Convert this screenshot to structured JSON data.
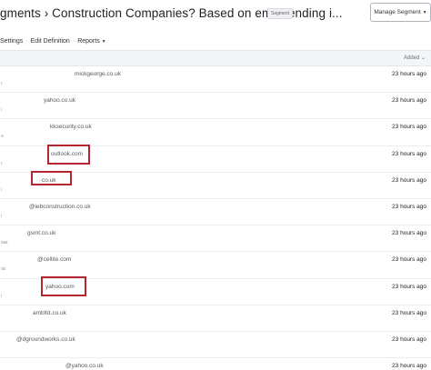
{
  "header": {
    "title": "gments › Construction Companies? Based on email ending i...",
    "badge": "Segment",
    "manage_button": "Manage Segment"
  },
  "subnav": {
    "items": [
      "Settings",
      "Edit Definition",
      "Reports"
    ]
  },
  "table": {
    "column_added": "Added",
    "rows": [
      {
        "left": "",
        "email": "mickgeorge.co.uk",
        "time": "23 hours ago"
      },
      {
        "left": "",
        "email": "yahoo.co.uk",
        "time": "23 hours ago"
      },
      {
        "left": "",
        "email": "kksecurity.co.uk",
        "time": "23 hours ago"
      },
      {
        "left": "",
        "email": "outlook.com",
        "time": "23 hours ago"
      },
      {
        "left": "",
        "email": "co.uk",
        "time": "23 hours ago"
      },
      {
        "left": "",
        "email": "@iebconstruction.co.uk",
        "time": "23 hours ago"
      },
      {
        "left": "Mat",
        "email": "gsmt.co.uk",
        "time": "23 hours ago"
      },
      {
        "left": "Sti",
        "email": "@cellite.com",
        "time": "23 hours ago"
      },
      {
        "left": "",
        "email": "yahoo.com",
        "time": "23 hours ago"
      },
      {
        "left": "",
        "email": "ambltd.co.uk",
        "time": "23 hours ago"
      },
      {
        "left": "",
        "email": "@dgroundworks.co.uk",
        "time": "23 hours ago"
      },
      {
        "left": "",
        "email": "@yahoo.co.uk",
        "time": "23 hours ago"
      }
    ]
  },
  "colors": {
    "highlight": "#b5252f",
    "header_bg": "#f3f5f7",
    "border": "#e3e6ea"
  }
}
